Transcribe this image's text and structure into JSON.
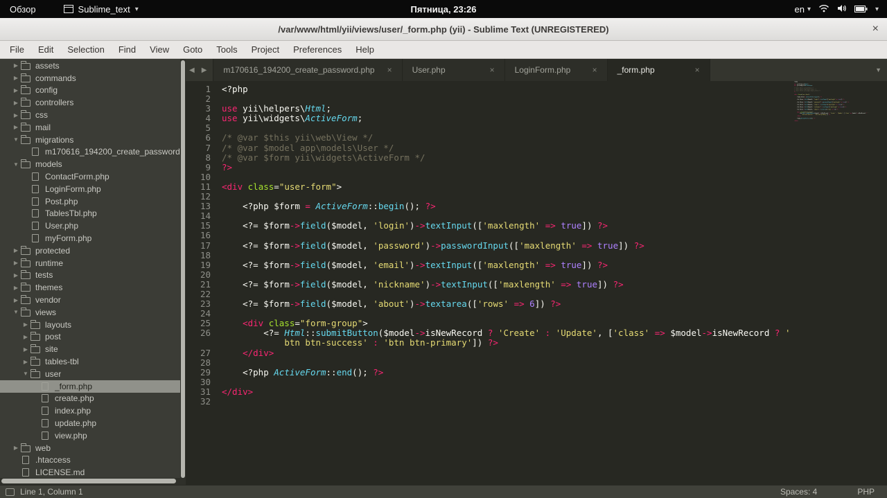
{
  "desktop": {
    "activities_label": "Обзор",
    "app_menu_label": "Sublime_text",
    "clock": "Пятница, 23:26",
    "keyboard_layout": "en"
  },
  "window": {
    "title": "/var/www/html/yii/views/user/_form.php (yii) - Sublime Text (UNREGISTERED)"
  },
  "menu": {
    "items": [
      "File",
      "Edit",
      "Selection",
      "Find",
      "View",
      "Goto",
      "Tools",
      "Project",
      "Preferences",
      "Help"
    ]
  },
  "icons": {
    "close": "×",
    "caret_down": "▾",
    "tab_dropdown": "▼",
    "nav_back": "◀",
    "nav_forward": "▶",
    "tree_collapsed": "▶",
    "tree_expanded": "▼"
  },
  "tabs": [
    {
      "label": "m170616_194200_create_password.php",
      "active": false
    },
    {
      "label": "User.php",
      "active": false
    },
    {
      "label": "LoginForm.php",
      "active": false
    },
    {
      "label": "_form.php",
      "active": true
    }
  ],
  "sidebar": {
    "items": [
      {
        "label": "assets",
        "level": 1,
        "kind": "folder",
        "state": "collapsed"
      },
      {
        "label": "commands",
        "level": 1,
        "kind": "folder",
        "state": "collapsed"
      },
      {
        "label": "config",
        "level": 1,
        "kind": "folder",
        "state": "collapsed"
      },
      {
        "label": "controllers",
        "level": 1,
        "kind": "folder",
        "state": "collapsed"
      },
      {
        "label": "css",
        "level": 1,
        "kind": "folder",
        "state": "collapsed"
      },
      {
        "label": "mail",
        "level": 1,
        "kind": "folder",
        "state": "collapsed"
      },
      {
        "label": "migrations",
        "level": 1,
        "kind": "folder",
        "state": "expanded"
      },
      {
        "label": "m170616_194200_create_password.",
        "level": 2,
        "kind": "file"
      },
      {
        "label": "models",
        "level": 1,
        "kind": "folder",
        "state": "expanded"
      },
      {
        "label": "ContactForm.php",
        "level": 2,
        "kind": "file"
      },
      {
        "label": "LoginForm.php",
        "level": 2,
        "kind": "file"
      },
      {
        "label": "Post.php",
        "level": 2,
        "kind": "file"
      },
      {
        "label": "TablesTbl.php",
        "level": 2,
        "kind": "file"
      },
      {
        "label": "User.php",
        "level": 2,
        "kind": "file"
      },
      {
        "label": "myForm.php",
        "level": 2,
        "kind": "file"
      },
      {
        "label": "protected",
        "level": 1,
        "kind": "folder",
        "state": "collapsed"
      },
      {
        "label": "runtime",
        "level": 1,
        "kind": "folder",
        "state": "collapsed"
      },
      {
        "label": "tests",
        "level": 1,
        "kind": "folder",
        "state": "collapsed"
      },
      {
        "label": "themes",
        "level": 1,
        "kind": "folder",
        "state": "collapsed"
      },
      {
        "label": "vendor",
        "level": 1,
        "kind": "folder",
        "state": "collapsed"
      },
      {
        "label": "views",
        "level": 1,
        "kind": "folder",
        "state": "expanded"
      },
      {
        "label": "layouts",
        "level": 2,
        "kind": "folder",
        "state": "collapsed"
      },
      {
        "label": "post",
        "level": 2,
        "kind": "folder",
        "state": "collapsed"
      },
      {
        "label": "site",
        "level": 2,
        "kind": "folder",
        "state": "collapsed"
      },
      {
        "label": "tables-tbl",
        "level": 2,
        "kind": "folder",
        "state": "collapsed"
      },
      {
        "label": "user",
        "level": 2,
        "kind": "folder",
        "state": "expanded"
      },
      {
        "label": "_form.php",
        "level": 3,
        "kind": "file",
        "selected": true
      },
      {
        "label": "create.php",
        "level": 3,
        "kind": "file"
      },
      {
        "label": "index.php",
        "level": 3,
        "kind": "file"
      },
      {
        "label": "update.php",
        "level": 3,
        "kind": "file"
      },
      {
        "label": "view.php",
        "level": 3,
        "kind": "file"
      },
      {
        "label": "web",
        "level": 1,
        "kind": "folder",
        "state": "collapsed"
      },
      {
        "label": ".htaccess",
        "level": 1,
        "kind": "file"
      },
      {
        "label": "LICENSE.md",
        "level": 1,
        "kind": "file"
      }
    ]
  },
  "editor": {
    "lines": [
      {
        "n": "1",
        "s": [
          [
            "<?php",
            "pl"
          ]
        ]
      },
      {
        "n": "2",
        "s": []
      },
      {
        "n": "3",
        "s": [
          [
            "use",
            "kw"
          ],
          [
            " yii\\helpers\\",
            "pl"
          ],
          [
            "Html",
            "ty"
          ],
          [
            ";",
            "pl"
          ]
        ]
      },
      {
        "n": "4",
        "s": [
          [
            "use",
            "kw"
          ],
          [
            " yii\\widgets\\",
            "pl"
          ],
          [
            "ActiveForm",
            "ty"
          ],
          [
            ";",
            "pl"
          ]
        ]
      },
      {
        "n": "5",
        "s": []
      },
      {
        "n": "6",
        "s": [
          [
            "/* @var $this yii\\web\\View */",
            "cm"
          ]
        ]
      },
      {
        "n": "7",
        "s": [
          [
            "/* @var $model app\\models\\User */",
            "cm"
          ]
        ]
      },
      {
        "n": "8",
        "s": [
          [
            "/* @var $form yii\\widgets\\ActiveForm */",
            "cm"
          ]
        ]
      },
      {
        "n": "9",
        "s": [
          [
            "?>",
            "kw"
          ]
        ]
      },
      {
        "n": "10",
        "s": []
      },
      {
        "n": "11",
        "s": [
          [
            "<div ",
            "kw"
          ],
          [
            "class",
            "at"
          ],
          [
            "=",
            "pl"
          ],
          [
            "\"user-form\"",
            "st"
          ],
          [
            ">",
            "pl"
          ]
        ]
      },
      {
        "n": "12",
        "s": []
      },
      {
        "n": "13",
        "s": [
          [
            "    <?php ",
            "pl"
          ],
          [
            "$form ",
            "pl"
          ],
          [
            "=",
            "kw"
          ],
          [
            " ",
            "pl"
          ],
          [
            "ActiveForm",
            "ty"
          ],
          [
            "::",
            "pl"
          ],
          [
            "begin",
            "fn"
          ],
          [
            "(); ",
            "pl"
          ],
          [
            "?>",
            "kw"
          ]
        ]
      },
      {
        "n": "14",
        "s": []
      },
      {
        "n": "15",
        "s": [
          [
            "    <?= ",
            "pl"
          ],
          [
            "$form",
            "pl"
          ],
          [
            "->",
            "kw"
          ],
          [
            "field",
            "fn"
          ],
          [
            "(",
            "pl"
          ],
          [
            "$model",
            "pl"
          ],
          [
            ", ",
            "pl"
          ],
          [
            "'login'",
            "st"
          ],
          [
            ")",
            "pl"
          ],
          [
            "->",
            "kw"
          ],
          [
            "textInput",
            "fn"
          ],
          [
            "([",
            "pl"
          ],
          [
            "'maxlength'",
            "st"
          ],
          [
            " ",
            "pl"
          ],
          [
            "=>",
            "kw"
          ],
          [
            " ",
            "pl"
          ],
          [
            "true",
            "ct"
          ],
          [
            "]) ",
            "pl"
          ],
          [
            "?>",
            "kw"
          ]
        ]
      },
      {
        "n": "16",
        "s": []
      },
      {
        "n": "17",
        "s": [
          [
            "    <?= ",
            "pl"
          ],
          [
            "$form",
            "pl"
          ],
          [
            "->",
            "kw"
          ],
          [
            "field",
            "fn"
          ],
          [
            "(",
            "pl"
          ],
          [
            "$model",
            "pl"
          ],
          [
            ", ",
            "pl"
          ],
          [
            "'password'",
            "st"
          ],
          [
            ")",
            "pl"
          ],
          [
            "->",
            "kw"
          ],
          [
            "passwordInput",
            "fn"
          ],
          [
            "([",
            "pl"
          ],
          [
            "'maxlength'",
            "st"
          ],
          [
            " ",
            "pl"
          ],
          [
            "=>",
            "kw"
          ],
          [
            " ",
            "pl"
          ],
          [
            "true",
            "ct"
          ],
          [
            "]) ",
            "pl"
          ],
          [
            "?>",
            "kw"
          ]
        ]
      },
      {
        "n": "18",
        "s": []
      },
      {
        "n": "19",
        "s": [
          [
            "    <?= ",
            "pl"
          ],
          [
            "$form",
            "pl"
          ],
          [
            "->",
            "kw"
          ],
          [
            "field",
            "fn"
          ],
          [
            "(",
            "pl"
          ],
          [
            "$model",
            "pl"
          ],
          [
            ", ",
            "pl"
          ],
          [
            "'email'",
            "st"
          ],
          [
            ")",
            "pl"
          ],
          [
            "->",
            "kw"
          ],
          [
            "textInput",
            "fn"
          ],
          [
            "([",
            "pl"
          ],
          [
            "'maxlength'",
            "st"
          ],
          [
            " ",
            "pl"
          ],
          [
            "=>",
            "kw"
          ],
          [
            " ",
            "pl"
          ],
          [
            "true",
            "ct"
          ],
          [
            "]) ",
            "pl"
          ],
          [
            "?>",
            "kw"
          ]
        ]
      },
      {
        "n": "20",
        "s": []
      },
      {
        "n": "21",
        "s": [
          [
            "    <?= ",
            "pl"
          ],
          [
            "$form",
            "pl"
          ],
          [
            "->",
            "kw"
          ],
          [
            "field",
            "fn"
          ],
          [
            "(",
            "pl"
          ],
          [
            "$model",
            "pl"
          ],
          [
            ", ",
            "pl"
          ],
          [
            "'nickname'",
            "st"
          ],
          [
            ")",
            "pl"
          ],
          [
            "->",
            "kw"
          ],
          [
            "textInput",
            "fn"
          ],
          [
            "([",
            "pl"
          ],
          [
            "'maxlength'",
            "st"
          ],
          [
            " ",
            "pl"
          ],
          [
            "=>",
            "kw"
          ],
          [
            " ",
            "pl"
          ],
          [
            "true",
            "ct"
          ],
          [
            "]) ",
            "pl"
          ],
          [
            "?>",
            "kw"
          ]
        ]
      },
      {
        "n": "22",
        "s": []
      },
      {
        "n": "23",
        "s": [
          [
            "    <?= ",
            "pl"
          ],
          [
            "$form",
            "pl"
          ],
          [
            "->",
            "kw"
          ],
          [
            "field",
            "fn"
          ],
          [
            "(",
            "pl"
          ],
          [
            "$model",
            "pl"
          ],
          [
            ", ",
            "pl"
          ],
          [
            "'about'",
            "st"
          ],
          [
            ")",
            "pl"
          ],
          [
            "->",
            "kw"
          ],
          [
            "textarea",
            "fn"
          ],
          [
            "([",
            "pl"
          ],
          [
            "'rows'",
            "st"
          ],
          [
            " ",
            "pl"
          ],
          [
            "=>",
            "kw"
          ],
          [
            " ",
            "pl"
          ],
          [
            "6",
            "ct"
          ],
          [
            "]) ",
            "pl"
          ],
          [
            "?>",
            "kw"
          ]
        ]
      },
      {
        "n": "24",
        "s": []
      },
      {
        "n": "25",
        "s": [
          [
            "    <div ",
            "kw"
          ],
          [
            "class",
            "at"
          ],
          [
            "=",
            "pl"
          ],
          [
            "\"form-group\"",
            "st"
          ],
          [
            ">",
            "pl"
          ]
        ]
      },
      {
        "n": "26",
        "s": [
          [
            "        <?= ",
            "pl"
          ],
          [
            "Html",
            "ty"
          ],
          [
            "::",
            "pl"
          ],
          [
            "submitButton",
            "fn"
          ],
          [
            "(",
            "pl"
          ],
          [
            "$model",
            "pl"
          ],
          [
            "->",
            "kw"
          ],
          [
            "isNewRecord ",
            "pl"
          ],
          [
            "?",
            "kw"
          ],
          [
            " ",
            "pl"
          ],
          [
            "'Create'",
            "st"
          ],
          [
            " ",
            "pl"
          ],
          [
            ":",
            "kw"
          ],
          [
            " ",
            "pl"
          ],
          [
            "'Update'",
            "st"
          ],
          [
            ", [",
            "pl"
          ],
          [
            "'class'",
            "st"
          ],
          [
            " ",
            "pl"
          ],
          [
            "=>",
            "kw"
          ],
          [
            " ",
            "pl"
          ],
          [
            "$model",
            "pl"
          ],
          [
            "->",
            "kw"
          ],
          [
            "isNewRecord ",
            "pl"
          ],
          [
            "?",
            "kw"
          ],
          [
            " ",
            "pl"
          ],
          [
            "'",
            "st"
          ]
        ]
      },
      {
        "n": "",
        "s": [
          [
            "            ",
            "pl"
          ],
          [
            "btn btn-success'",
            "st"
          ],
          [
            " ",
            "pl"
          ],
          [
            ":",
            "kw"
          ],
          [
            " ",
            "pl"
          ],
          [
            "'btn btn-primary'",
            "st"
          ],
          [
            "]) ",
            "pl"
          ],
          [
            "?>",
            "kw"
          ]
        ]
      },
      {
        "n": "27",
        "s": [
          [
            "    ",
            "pl"
          ],
          [
            "</div>",
            "kw"
          ]
        ]
      },
      {
        "n": "28",
        "s": []
      },
      {
        "n": "29",
        "s": [
          [
            "    <?php ",
            "pl"
          ],
          [
            "ActiveForm",
            "ty"
          ],
          [
            "::",
            "pl"
          ],
          [
            "end",
            "fn"
          ],
          [
            "(); ",
            "pl"
          ],
          [
            "?>",
            "kw"
          ]
        ]
      },
      {
        "n": "30",
        "s": []
      },
      {
        "n": "31",
        "s": [
          [
            "</div>",
            "kw"
          ]
        ]
      },
      {
        "n": "32",
        "s": []
      }
    ]
  },
  "status_bar": {
    "position": "Line 1, Column 1",
    "indent": "Spaces: 4",
    "syntax": "PHP"
  },
  "theme": {
    "editor_bg": "#272822",
    "sidebar_bg": "#3b3c36",
    "accent_pink": "#f92672",
    "accent_blue": "#66d9ef",
    "accent_yellow": "#e6db74",
    "accent_purple": "#ae81ff",
    "accent_green": "#a6e22e",
    "comment_gray": "#75715e"
  }
}
